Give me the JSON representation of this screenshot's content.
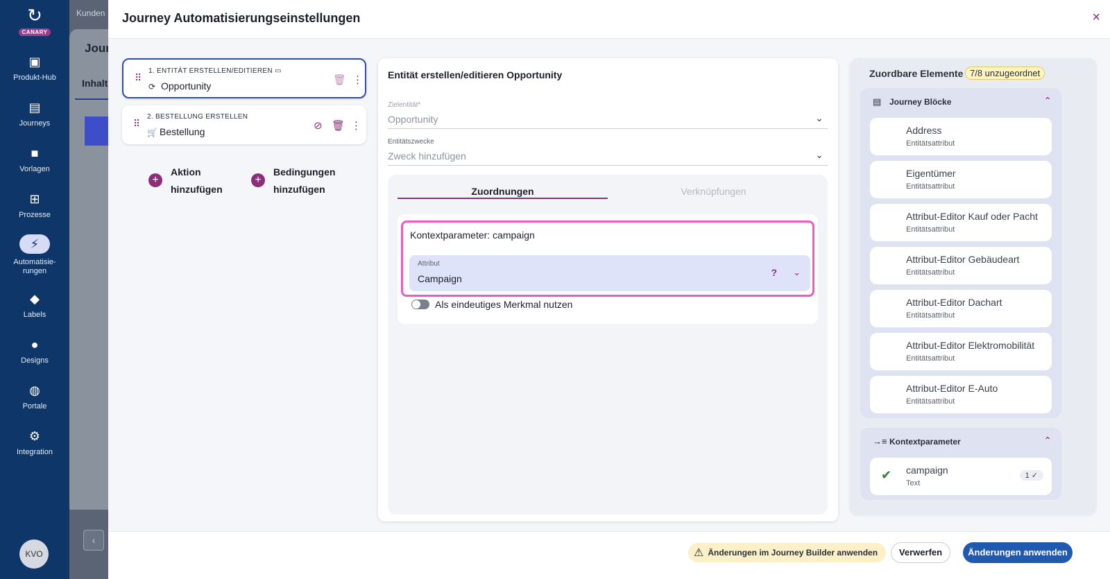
{
  "leftnav": {
    "logo_text": "CANARY",
    "items": [
      {
        "label": "Produkt-Hub",
        "icon": "book-icon"
      },
      {
        "label": "Journeys",
        "icon": "layout-icon"
      },
      {
        "label": "Vorlagen",
        "icon": "folder-icon"
      },
      {
        "label": "Prozesse",
        "icon": "process-icon"
      },
      {
        "label": "Automatisie-rungen",
        "icon": "bolt-icon"
      },
      {
        "label": "Labels",
        "icon": "label-icon"
      },
      {
        "label": "Designs",
        "icon": "palette-icon"
      },
      {
        "label": "Portale",
        "icon": "globe-icon"
      },
      {
        "label": "Integration",
        "icon": "webhook-icon"
      }
    ],
    "avatar_initials": "KVO"
  },
  "background_app": {
    "breadcrumb": "Kunden",
    "title": "Jour",
    "tab": "Inhalt"
  },
  "modal": {
    "title": "Journey Automatisierungseinstellungen",
    "close_label": "×"
  },
  "steps": [
    {
      "label": "1. ENTITÄT ERSTELLEN/EDITIEREN",
      "value": "Opportunity",
      "value_icon": "sync-icon"
    },
    {
      "label": "2. BESTELLUNG ERSTELLEN",
      "value": "Bestellung",
      "value_icon": "cart-icon"
    }
  ],
  "add_actions": {
    "action_line1": "Aktion",
    "action_line2": "hinzufügen",
    "condition_line1": "Bedingungen",
    "condition_line2": "hinzufügen"
  },
  "editor": {
    "title": "Entität erstellen/editieren Opportunity",
    "target_label": "Zielentität*",
    "target_value": "Opportunity",
    "purpose_label": "Entitätszwecke",
    "purpose_placeholder": "Zweck hinzufügen",
    "tabs": [
      "Zuordnungen",
      "Verknüpfungen"
    ],
    "mapping_title": "Kontextparameter: campaign",
    "attribute_label": "Attribut",
    "attribute_value": "Campaign",
    "help_glyph": "?",
    "unique_toggle_label": "Als eindeutiges Merkmal nutzen"
  },
  "assignable": {
    "title": "Zuordbare Elemente",
    "badge": "7/8 unzugeordnet",
    "journey_blocks_title": "Journey Blöcke",
    "journey_blocks": [
      {
        "name": "Address",
        "type": "Entitätsattribut"
      },
      {
        "name": "Eigentümer",
        "type": "Entitätsattribut"
      },
      {
        "name": "Attribut-Editor Kauf oder Pacht",
        "type": "Entitätsattribut"
      },
      {
        "name": "Attribut-Editor Gebäudeart",
        "type": "Entitätsattribut"
      },
      {
        "name": "Attribut-Editor Dachart",
        "type": "Entitätsattribut"
      },
      {
        "name": "Attribut-Editor Elektromobilität",
        "type": "Entitätsattribut"
      },
      {
        "name": "Attribut-Editor E-Auto",
        "type": "Entitätsattribut"
      }
    ],
    "context_title": "Kontextparameter",
    "context_params": [
      {
        "name": "campaign",
        "type": "Text",
        "count": "1"
      }
    ]
  },
  "footer": {
    "warning": "Änderungen im Journey Builder anwenden",
    "discard": "Verwerfen",
    "apply": "Änderungen anwenden"
  }
}
